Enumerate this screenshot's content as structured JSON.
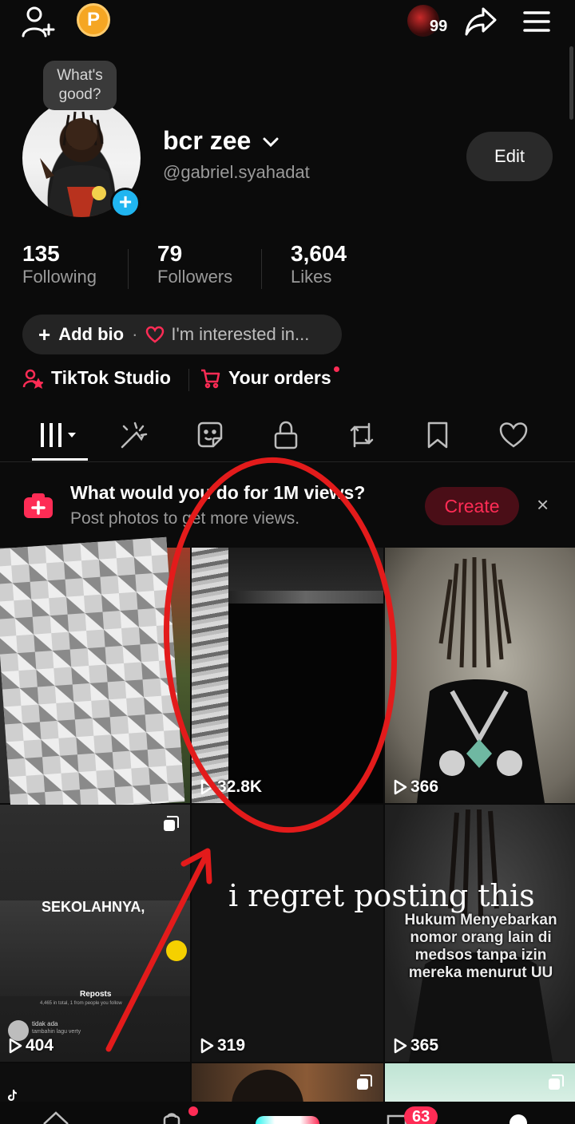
{
  "topbar": {
    "icons": [
      "add-friend-icon",
      "coin-icon",
      "inbox-avatar",
      "share-icon",
      "menu-icon"
    ],
    "coin_letter": "P",
    "inbox_count": "99"
  },
  "profile": {
    "bubble_text": "What's good?",
    "display_name": "bcr zee",
    "username": "@gabriel.syahadat",
    "edit_label": "Edit"
  },
  "stats": [
    {
      "value": "135",
      "label": "Following"
    },
    {
      "value": "79",
      "label": "Followers"
    },
    {
      "value": "3,604",
      "label": "Likes"
    }
  ],
  "bio": {
    "add_bio": "Add bio",
    "separator": "·",
    "interested": "I'm interested in..."
  },
  "shortcuts": {
    "studio": "TikTok Studio",
    "orders": "Your orders"
  },
  "tabs": [
    "videos-grid-icon",
    "highlights-icon",
    "stickers-icon",
    "private-lock-icon",
    "reposts-icon",
    "saved-bookmark-icon",
    "liked-heart-icon"
  ],
  "promo": {
    "title": "What would you do for 1M views?",
    "subtitle": "Post photos to get more views.",
    "create_label": "Create",
    "close": "×"
  },
  "grid": [
    {
      "views": ""
    },
    {
      "views": "32.8K"
    },
    {
      "views": "366"
    },
    {
      "views": "404",
      "caption": "SEKOLAHNYA,",
      "sheet_title": "Reposts",
      "sheet_sub": "4,465 in total, 1 from people you follow",
      "sheet_item1": "tidak ada",
      "sheet_item2": "tambahin lagu verty"
    },
    {
      "views": "319"
    },
    {
      "views": "365",
      "overlay": "Hukum Menyebarkan nomor orang lain di medsos tanpa izin mereka menurut UU"
    }
  ],
  "annotation": {
    "text": "i regret posting this",
    "color": "#e31b1b"
  },
  "bottomnav": {
    "inbox_badge": "63"
  },
  "colors": {
    "accent": "#fe2c55",
    "background": "#0b0b0b",
    "secondary_text": "#9a9a9a"
  }
}
